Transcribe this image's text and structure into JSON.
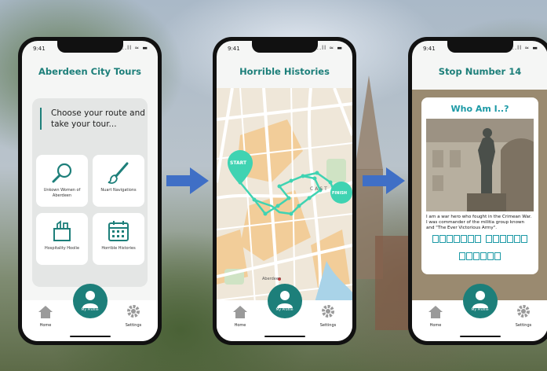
{
  "status": {
    "time": "9:41",
    "icons": "..ll ≈ ▬"
  },
  "nav": {
    "home": "Home",
    "profile": "My Profile",
    "settings": "Settings"
  },
  "phone1": {
    "title": "Aberdeen City Tours",
    "prompt": "Choose your route and take your tour...",
    "tiles": [
      {
        "label": "Unkown Women of Aberdeen",
        "icon": "magnifier-icon"
      },
      {
        "label": "Nuart Navigations",
        "icon": "paintbrush-icon"
      },
      {
        "label": "Hospitality Hoolie",
        "icon": "shopping-bag-icon"
      },
      {
        "label": "Horrible Histories",
        "icon": "calendar-icon"
      }
    ]
  },
  "phone2": {
    "title": "Horrible Histories",
    "start": "START",
    "finish": "FINISH",
    "map_labels": {
      "area": "CAST",
      "place": "Aberdeen"
    }
  },
  "phone3": {
    "title": "Stop Number 14",
    "quiz_title": "Who Am I..?",
    "clue": "I am a war hero who fought in the Crimean War. I was commander of the militia group known and \"The Ever Victorious Army\".",
    "answer_pattern": [
      [
        7,
        6
      ],
      [
        6
      ]
    ]
  },
  "colors": {
    "teal": "#1d7f7a",
    "quiz_teal": "#1d9aa6",
    "route": "#3fd3b2",
    "arrow": "#3f6fc6"
  }
}
